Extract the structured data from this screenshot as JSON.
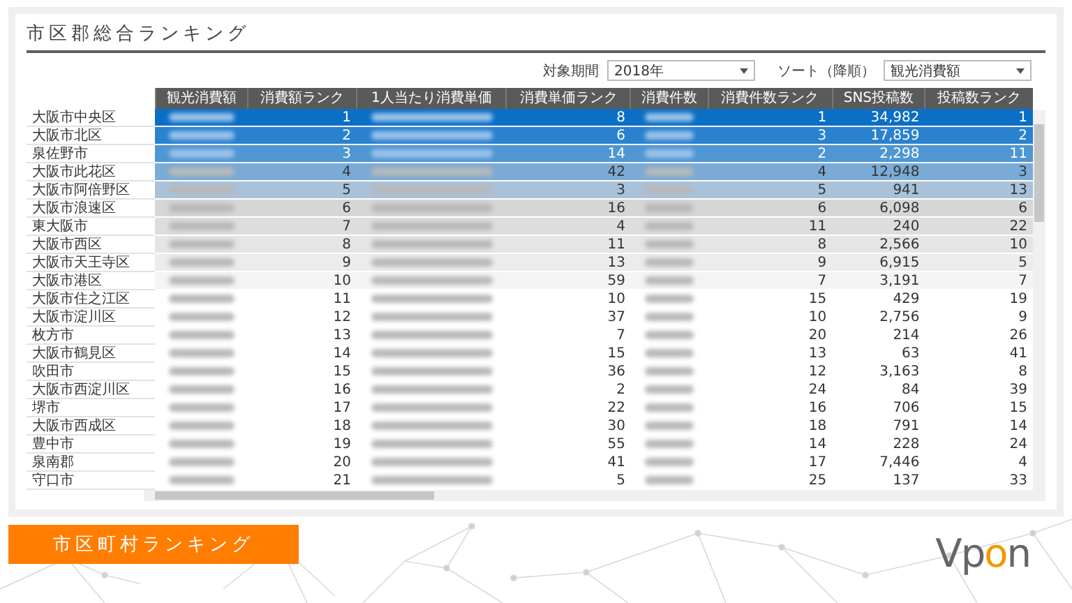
{
  "title": "市区郡総合ランキング",
  "filters": [
    {
      "label": "対象期間",
      "value": "2018年"
    },
    {
      "label": "ソート（降順）",
      "value": "観光消費額"
    }
  ],
  "table": {
    "columns": [
      {
        "label": "観光消費額",
        "kind": "blurred"
      },
      {
        "label": "消費額ランク",
        "kind": "number"
      },
      {
        "label": "1人当たり消費単価",
        "kind": "blurred"
      },
      {
        "label": "消費単価ランク",
        "kind": "number"
      },
      {
        "label": "消費件数",
        "kind": "blurred"
      },
      {
        "label": "消費件数ランク",
        "kind": "number"
      },
      {
        "label": "SNS投稿数",
        "kind": "number"
      },
      {
        "label": "投稿数ランク",
        "kind": "number"
      }
    ],
    "rows": [
      {
        "name": "大阪市中央区",
        "color": "#0b6fc6",
        "values": [
          "1",
          "8",
          "1",
          "34,982",
          "1"
        ]
      },
      {
        "name": "大阪市北区",
        "color": "#2a82cf",
        "values": [
          "2",
          "6",
          "3",
          "17,859",
          "2"
        ]
      },
      {
        "name": "泉佐野市",
        "color": "#4f97d3",
        "values": [
          "3",
          "14",
          "2",
          "2,298",
          "11"
        ]
      },
      {
        "name": "大阪市此花区",
        "color": "#7aabd6",
        "values": [
          "4",
          "42",
          "4",
          "12,948",
          "3"
        ]
      },
      {
        "name": "大阪市阿倍野区",
        "color": "#a9c2da",
        "values": [
          "5",
          "3",
          "5",
          "941",
          "13"
        ]
      },
      {
        "name": "大阪市浪速区",
        "color": "#d6d6d6",
        "values": [
          "6",
          "16",
          "6",
          "6,098",
          "6"
        ]
      },
      {
        "name": "東大阪市",
        "color": "#dddddd",
        "values": [
          "7",
          "4",
          "11",
          "240",
          "22"
        ]
      },
      {
        "name": "大阪市西区",
        "color": "#e5e5e5",
        "values": [
          "8",
          "11",
          "8",
          "2,566",
          "10"
        ]
      },
      {
        "name": "大阪市天王寺区",
        "color": "#ececec",
        "values": [
          "9",
          "13",
          "9",
          "6,915",
          "5"
        ]
      },
      {
        "name": "大阪市港区",
        "color": "#f4f4f4",
        "values": [
          "10",
          "59",
          "7",
          "3,191",
          "7"
        ]
      },
      {
        "name": "大阪市住之江区",
        "color": "#ffffff",
        "values": [
          "11",
          "10",
          "15",
          "429",
          "19"
        ]
      },
      {
        "name": "大阪市淀川区",
        "color": "#ffffff",
        "values": [
          "12",
          "37",
          "10",
          "2,756",
          "9"
        ]
      },
      {
        "name": "枚方市",
        "color": "#ffffff",
        "values": [
          "13",
          "7",
          "20",
          "214",
          "26"
        ]
      },
      {
        "name": "大阪市鶴見区",
        "color": "#ffffff",
        "values": [
          "14",
          "15",
          "13",
          "63",
          "41"
        ]
      },
      {
        "name": "吹田市",
        "color": "#ffffff",
        "values": [
          "15",
          "36",
          "12",
          "3,163",
          "8"
        ]
      },
      {
        "name": "大阪市西淀川区",
        "color": "#ffffff",
        "values": [
          "16",
          "2",
          "24",
          "84",
          "39"
        ]
      },
      {
        "name": "堺市",
        "color": "#ffffff",
        "values": [
          "17",
          "22",
          "16",
          "706",
          "15"
        ]
      },
      {
        "name": "大阪市西成区",
        "color": "#ffffff",
        "values": [
          "18",
          "30",
          "18",
          "791",
          "14"
        ]
      },
      {
        "name": "豊中市",
        "color": "#ffffff",
        "values": [
          "19",
          "55",
          "14",
          "228",
          "24"
        ]
      },
      {
        "name": "泉南郡",
        "color": "#ffffff",
        "values": [
          "20",
          "41",
          "17",
          "7,446",
          "4"
        ]
      },
      {
        "name": "守口市",
        "color": "#ffffff",
        "values": [
          "21",
          "5",
          "25",
          "137",
          "33"
        ]
      }
    ]
  },
  "banner": "市区町村ランキング",
  "logo": "Vpon"
}
